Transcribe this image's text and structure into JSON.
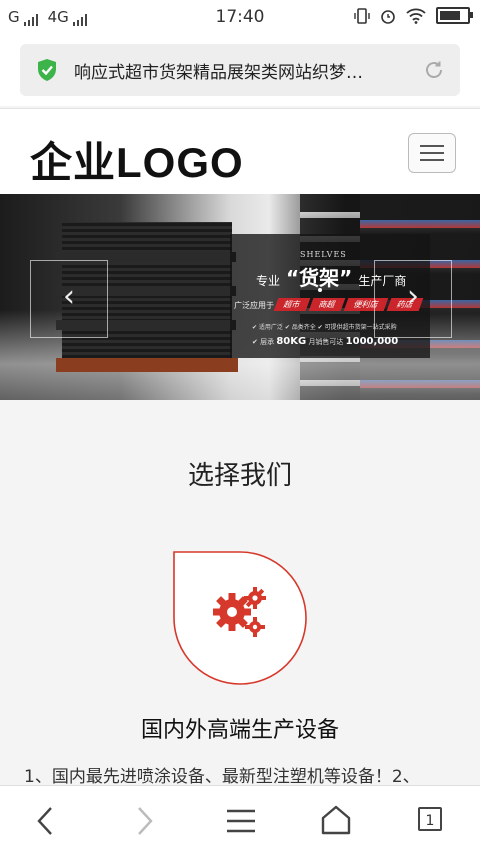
{
  "status_bar": {
    "carrier_1": "G",
    "carrier_2": "4G",
    "time": "17:40",
    "battery_level": 0.9
  },
  "address_bar": {
    "url_text": "响应式超市货架精品展架类网站织梦…",
    "secure_icon": "shield-check-icon",
    "reload_icon": "reload-icon"
  },
  "header": {
    "logo_text": "企业LOGO",
    "menu_icon": "hamburger-icon"
  },
  "banner": {
    "en_label": "SHELVES",
    "title_prefix": "专业",
    "title_main": "“货架”",
    "title_suffix": "生产厂商",
    "usage_label": "广泛应用于",
    "tags": [
      "超市",
      "商超",
      "便利店",
      "药店"
    ],
    "features": "✔ 适用广泛   ✔ 品类齐全   ✔ 可提供超市货架一站式采购",
    "stats_prefix": "✔ 层承",
    "stats_load": "80KG",
    "stats_mid": "月销售可达",
    "stats_sales": "1000,000",
    "prev_icon": "chevron-left-icon",
    "next_icon": "chevron-right-icon"
  },
  "choose_section": {
    "title": "选择我们",
    "feature_icon": "gears-icon",
    "feature_title": "国内外高端生产设备",
    "feature_desc": "1、国内最先进喷涂设备、最新型注塑机等设备！2、"
  },
  "bottom_nav": {
    "back_icon": "back-arrow-icon",
    "forward_icon": "forward-arrow-icon",
    "menu_icon": "menu-icon",
    "home_icon": "home-icon",
    "tab_count": "1"
  },
  "colors": {
    "accent_red": "#d6392b",
    "secure_green": "#3cb44a"
  }
}
